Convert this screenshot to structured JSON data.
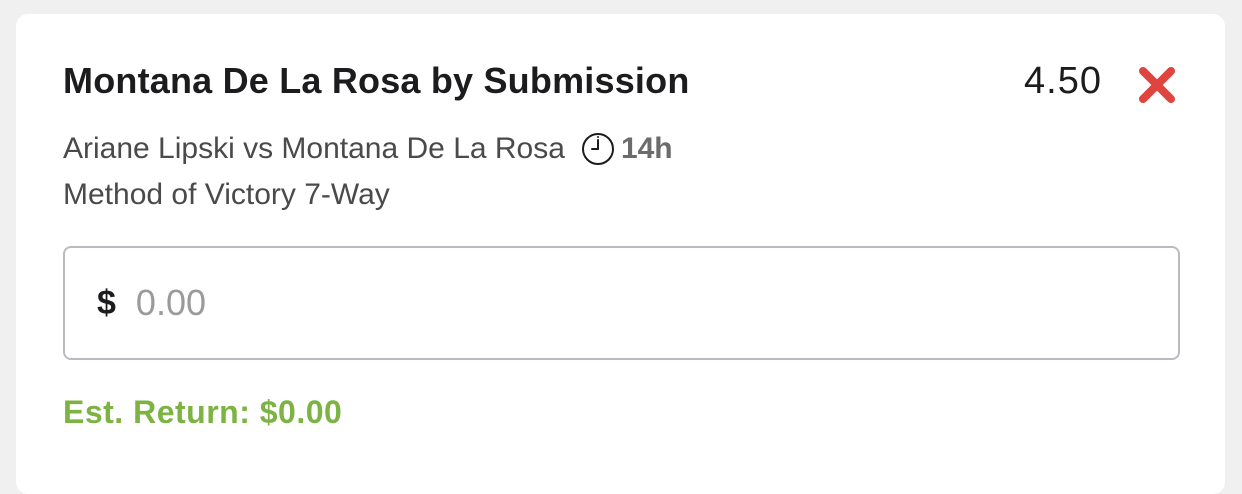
{
  "bet": {
    "selection": "Montana De La Rosa by Submission",
    "odds": "4.50",
    "matchup": "Ariane Lipski vs Montana De La Rosa",
    "countdown": "14h",
    "market": "Method of Victory 7-Way"
  },
  "stake": {
    "currency_symbol": "$",
    "value": "",
    "placeholder": "0.00"
  },
  "est_return": {
    "text": "Est. Return: $0.00"
  },
  "icons": {
    "remove": "close-icon",
    "time": "clock-icon"
  },
  "colors": {
    "remove_icon": "#e0443e",
    "est_return": "#7cb342",
    "input_border": "#b8bcc2"
  }
}
